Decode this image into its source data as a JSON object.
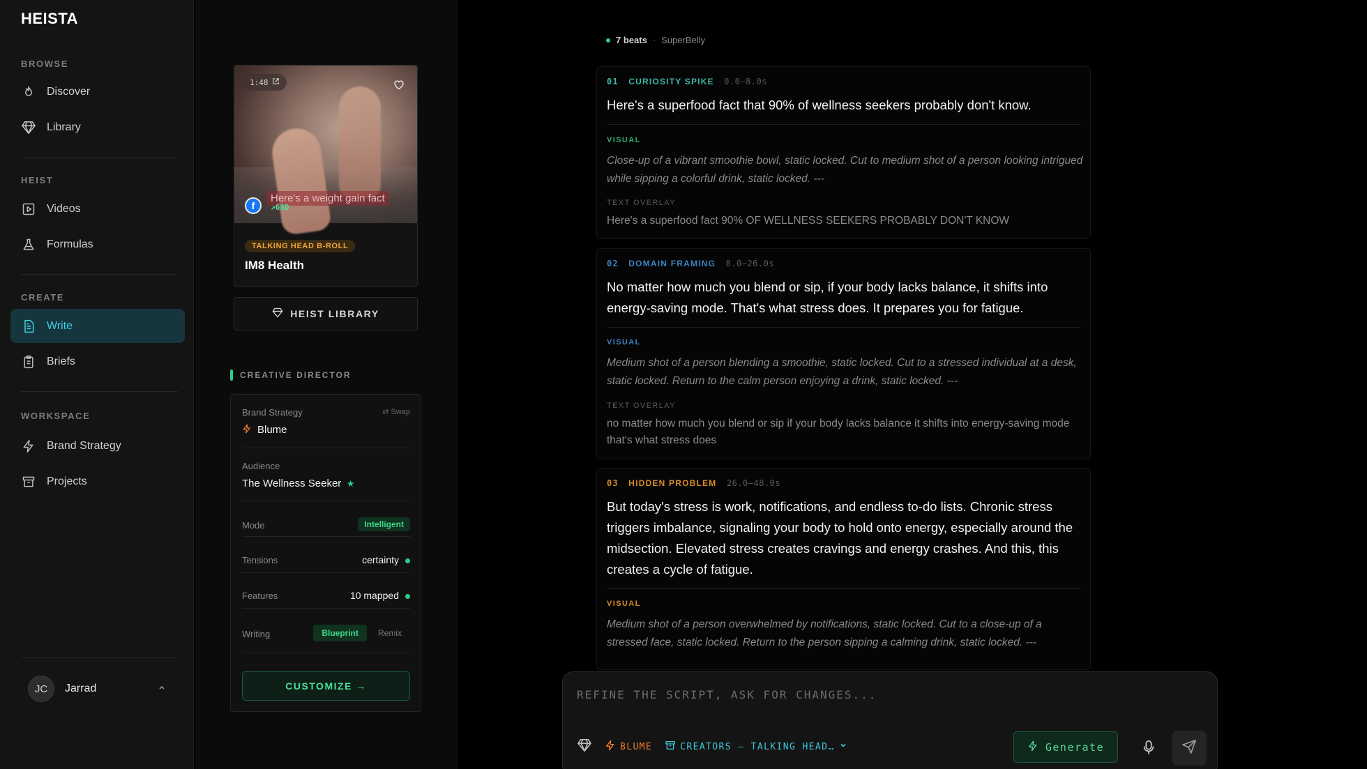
{
  "app": {
    "logo": "HEISTA"
  },
  "sidebar": {
    "sections": [
      {
        "label": "BROWSE"
      },
      {
        "label": "HEIST"
      },
      {
        "label": "CREATE"
      },
      {
        "label": "WORKSPACE"
      }
    ],
    "items": [
      {
        "label": "Discover",
        "icon": "flame-icon"
      },
      {
        "label": "Library",
        "icon": "gem-icon"
      },
      {
        "label": "Videos",
        "icon": "play-square-icon"
      },
      {
        "label": "Formulas",
        "icon": "flask-icon"
      },
      {
        "label": "Write",
        "icon": "document-icon",
        "active": true
      },
      {
        "label": "Briefs",
        "icon": "clipboard-icon"
      },
      {
        "label": "Brand Strategy",
        "icon": "bolt-icon"
      },
      {
        "label": "Projects",
        "icon": "archive-icon"
      }
    ],
    "user": {
      "initials": "JC",
      "name": "Jarrad"
    }
  },
  "video_card": {
    "duration": "1:48",
    "caption": "Here's a weight gain fact",
    "trend": "63D",
    "tag": "TALKING HEAD B-ROLL",
    "title": "IM8 Health"
  },
  "heist_library_button": "HEIST LIBRARY",
  "creative_director": {
    "label": "CREATIVE DIRECTOR",
    "brand_strategy_label": "Brand Strategy",
    "swap_label": "Swap",
    "brand_value": "Blume",
    "audience_label": "Audience",
    "audience_value": "The Wellness Seeker",
    "mode_label": "Mode",
    "mode_value": "Intelligent",
    "tensions_label": "Tensions",
    "tensions_value": "certainty",
    "features_label": "Features",
    "features_value": "10 mapped",
    "writing_label": "Writing",
    "writing_options": [
      "Blueprint",
      "Remix"
    ],
    "customize_button": "CUSTOMIZE →"
  },
  "script": {
    "beats_count": "7 beats",
    "source": "SuperBelly",
    "beats": [
      {
        "num": "01",
        "name": "CURIOSITY SPIKE",
        "time": "0.0–8.0s",
        "color": "#3fb7a8",
        "line": "Here's a superfood fact that 90% of wellness seekers probably don't know.",
        "visual_label": "VISUAL",
        "visual": "Close-up of a vibrant smoothie bowl, static locked. Cut to medium shot of a person looking intrigued while sipping a colorful drink, static locked. ---",
        "overlay_label": "TEXT OVERLAY",
        "overlay": "Here's a superfood fact 90% OF WELLNESS SEEKERS PROBABLY DON'T KNOW"
      },
      {
        "num": "02",
        "name": "DOMAIN FRAMING",
        "time": "8.0–26.0s",
        "color": "#3d82c4",
        "line": "No matter how much you blend or sip, if your body lacks balance, it shifts into energy-saving mode. That's what stress does. It prepares you for fatigue.",
        "visual_label": "VISUAL",
        "visual": "Medium shot of a person blending a smoothie, static locked. Cut to a stressed individual at a desk, static locked. Return to the calm person enjoying a drink, static locked. ---",
        "overlay_label": "TEXT OVERLAY",
        "overlay": "no matter how much you blend or sip if your body lacks balance it shifts into energy-saving mode that's what stress does"
      },
      {
        "num": "03",
        "name": "HIDDEN PROBLEM",
        "time": "26.0–48.0s",
        "color": "#d98a2b",
        "line": "But today's stress is work, notifications, and endless to-do lists. Chronic stress triggers imbalance, signaling your body to hold onto energy, especially around the midsection. Elevated stress creates cravings and energy crashes. And this, this creates a cycle of fatigue.",
        "visual_label": "VISUAL",
        "visual": "Medium shot of a person overwhelmed by notifications, static locked. Cut to a close-up of a stressed face, static locked. Return to the person sipping a calming drink, static locked. ---"
      }
    ]
  },
  "composer": {
    "placeholder": "REFINE THE SCRIPT, ASK FOR CHANGES...",
    "brand_chip": "BLUME",
    "creators_chip": "CREATORS – TALKING HEAD…",
    "generate_button": "Generate"
  }
}
